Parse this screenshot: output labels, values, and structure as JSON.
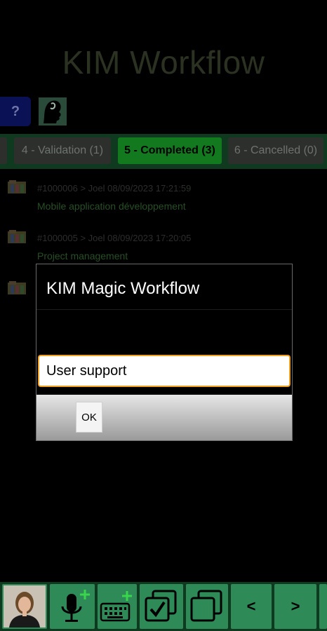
{
  "app": {
    "title": "KIM Workflow",
    "help_label": "?"
  },
  "tabs": [
    {
      "label": "4 - Validation (1)",
      "active": false
    },
    {
      "label": "5 - Completed (3)",
      "active": true
    },
    {
      "label": "6 - Cancelled (0)",
      "active": false
    }
  ],
  "items": [
    {
      "meta": "#1000006 > Joel 08/09/2023 17:21:59",
      "title": "Mobile application développement"
    },
    {
      "meta": "#1000005 > Joel 08/09/2023 17:20:05",
      "title": "Project management"
    }
  ],
  "dialog": {
    "title": "KIM Magic Workflow",
    "field_value": "User support",
    "ok_label": "OK"
  },
  "toolbar": {
    "prev_label": "<",
    "next_label": ">"
  },
  "colors": {
    "accent_green": "#2e8b57",
    "active_tab": "#12791f",
    "field_border": "#f0a020"
  }
}
